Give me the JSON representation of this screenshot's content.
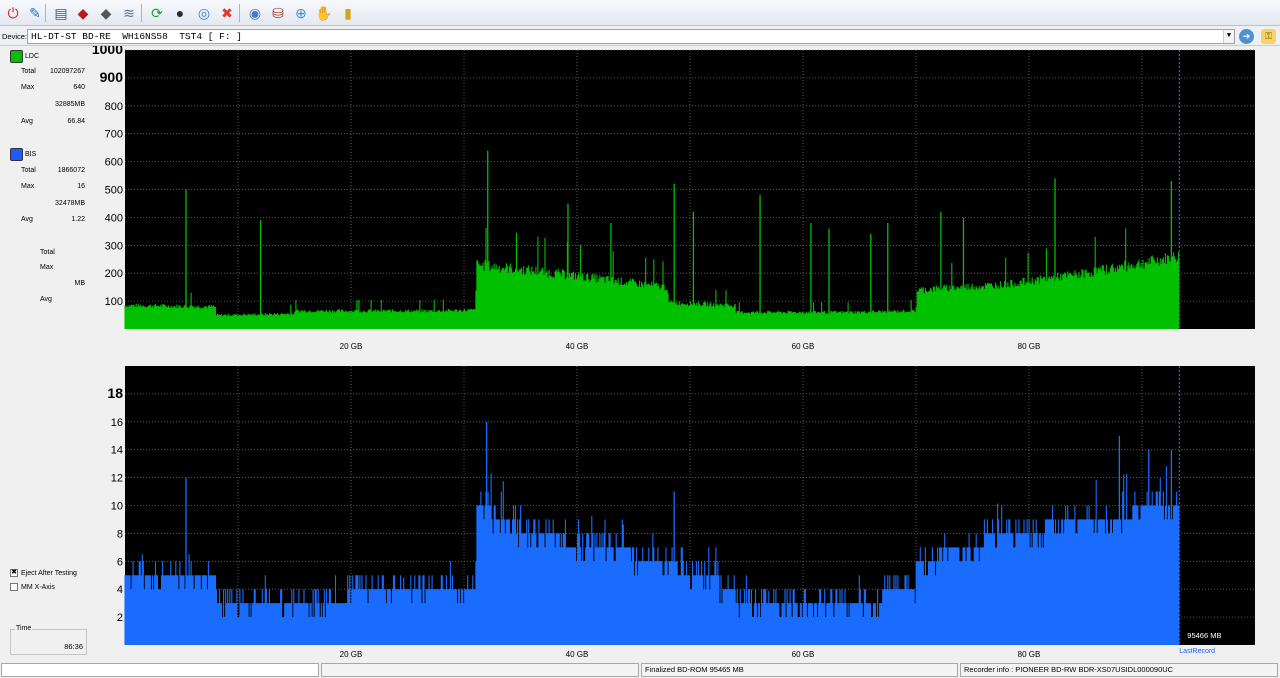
{
  "toolbar": {
    "buttons": [
      {
        "name": "power-icon",
        "glyph": "⏻",
        "color": "#d02020"
      },
      {
        "name": "settings-icon",
        "glyph": "✎",
        "color": "#2a6fc9"
      },
      {
        "name": "drive-info-icon",
        "glyph": "▤",
        "color": "#3a5a8a"
      },
      {
        "name": "disc-red-icon",
        "glyph": "◆",
        "color": "#b81c1c"
      },
      {
        "name": "disc-gray-icon",
        "glyph": "◆",
        "color": "#555555"
      },
      {
        "name": "disc-layers-icon",
        "glyph": "≋",
        "color": "#5a6e8c"
      },
      {
        "name": "refresh-icon",
        "glyph": "⟳",
        "color": "#1e9e3a"
      },
      {
        "name": "globe-icon",
        "glyph": "●",
        "color": "#2b2b2b"
      },
      {
        "name": "check-disc-icon",
        "glyph": "◎",
        "color": "#3b7bd0"
      },
      {
        "name": "stop-icon",
        "glyph": "✖",
        "color": "#e0392b"
      },
      {
        "name": "disc-blue-icon",
        "glyph": "◉",
        "color": "#4d79c8"
      },
      {
        "name": "scan-icon",
        "glyph": "⛁",
        "color": "#a03a2a"
      },
      {
        "name": "copy-disc-icon",
        "glyph": "⊕",
        "color": "#3a8fd0"
      },
      {
        "name": "palette-icon",
        "glyph": "✋",
        "color": "#d8704a"
      },
      {
        "name": "chart-icon",
        "glyph": "▮",
        "color": "#d6a21a"
      }
    ]
  },
  "device": {
    "label": "Device:",
    "value": "HL-DT-ST BD-RE  WH16NS58  TST4 [ F: ]"
  },
  "left_panel": {
    "ldc": {
      "label": "LDC",
      "color": "#00c000",
      "total_label": "Total",
      "total": "102097267",
      "max_label": "Max",
      "max": "640",
      "mb": "32885MB",
      "avg_label": "Avg",
      "avg": "66.84"
    },
    "bis": {
      "label": "BIS",
      "color": "#1a5cff",
      "total_label": "Total",
      "total": "1866072",
      "max_label": "Max",
      "max": "16",
      "mb": "32478MB",
      "avg_label": "Avg",
      "avg": "1.22"
    },
    "third": {
      "total_label": "Total",
      "max_label": "Max",
      "mb_label": "MB",
      "avg_label": "Avg"
    },
    "eject_label": "Eject After Testing",
    "eject_checked": true,
    "mm_label": "MM X-Axis",
    "mm_checked": false,
    "time_label": "Time",
    "time_value": "86:36"
  },
  "status_bar": {
    "field1": "",
    "field2": "",
    "finalized": "Finalized   BD-ROM     95465 MB",
    "recorder": "Recorder info : PIONEER          BD-RW  BDR-XS07USIDL000090UC"
  },
  "chart_data": [
    {
      "type": "area",
      "name": "LDC",
      "color": "#00c000",
      "xlim": [
        0,
        100
      ],
      "ylim": [
        0,
        1000
      ],
      "x_tick_labels": [
        "20 GB",
        "40 GB",
        "60 GB",
        "80 GB"
      ],
      "x_ticks": [
        20,
        40,
        60,
        80
      ],
      "y_ticks": [
        100,
        200,
        300,
        400,
        500,
        600,
        700,
        800,
        900,
        1000
      ],
      "y_tick_labels": [
        "100",
        "200",
        "300",
        "400",
        "500",
        "600",
        "700",
        "800",
        "900",
        "1000"
      ],
      "end_marker_gb": 93.3,
      "baseline": [
        [
          0,
          85
        ],
        [
          8,
          80
        ],
        [
          8.1,
          50
        ],
        [
          15,
          55
        ],
        [
          15.1,
          65
        ],
        [
          27,
          65
        ],
        [
          31,
          68
        ],
        [
          31.1,
          230
        ],
        [
          36,
          210
        ],
        [
          42,
          180
        ],
        [
          48,
          150
        ],
        [
          48.1,
          95
        ],
        [
          54,
          85
        ],
        [
          54.1,
          60
        ],
        [
          64,
          60
        ],
        [
          70,
          65
        ],
        [
          70.1,
          140
        ],
        [
          78,
          160
        ],
        [
          85,
          200
        ],
        [
          93.3,
          260
        ]
      ],
      "spikes": [
        [
          5.4,
          500
        ],
        [
          12,
          390
        ],
        [
          32.1,
          640
        ],
        [
          39.2,
          450
        ],
        [
          43,
          380
        ],
        [
          48.6,
          520
        ],
        [
          50.3,
          420
        ],
        [
          56.2,
          480
        ],
        [
          60.7,
          380
        ],
        [
          62.3,
          360
        ],
        [
          66,
          340
        ],
        [
          67.5,
          380
        ],
        [
          72.2,
          420
        ],
        [
          74.2,
          400
        ],
        [
          82.3,
          540
        ],
        [
          92.6,
          530
        ]
      ],
      "grid": true,
      "grid_style": "dotted",
      "background": "#000000"
    },
    {
      "type": "area",
      "name": "BIS",
      "color": "#1a6cff",
      "xlim": [
        0,
        100
      ],
      "ylim": [
        0,
        20
      ],
      "x_tick_labels": [
        "20 GB",
        "40 GB",
        "60 GB",
        "80 GB"
      ],
      "x_ticks": [
        20,
        40,
        60,
        80
      ],
      "y_ticks": [
        2,
        4,
        6,
        8,
        10,
        12,
        14,
        16,
        18
      ],
      "y_tick_labels": [
        "2",
        "4",
        "6",
        "8",
        "10",
        "12",
        "14",
        "16",
        "18"
      ],
      "end_marker_gb": 93.3,
      "baseline": [
        [
          0,
          5
        ],
        [
          8,
          5
        ],
        [
          8.1,
          3
        ],
        [
          31,
          4
        ],
        [
          31.1,
          10
        ],
        [
          36,
          8
        ],
        [
          42,
          7
        ],
        [
          48,
          6
        ],
        [
          54,
          4
        ],
        [
          54.1,
          3
        ],
        [
          64,
          3
        ],
        [
          70,
          4
        ],
        [
          70.1,
          6
        ],
        [
          78,
          8
        ],
        [
          85,
          9
        ],
        [
          93.3,
          10
        ]
      ],
      "spikes": [
        [
          5.4,
          12
        ],
        [
          32,
          16
        ],
        [
          48.6,
          11
        ],
        [
          88,
          15
        ],
        [
          90.6,
          14
        ],
        [
          92.6,
          14
        ]
      ],
      "grid": true,
      "grid_style": "dotted",
      "background": "#000000",
      "end_label": "95466 MB",
      "marker_label": "LastRecord"
    }
  ]
}
